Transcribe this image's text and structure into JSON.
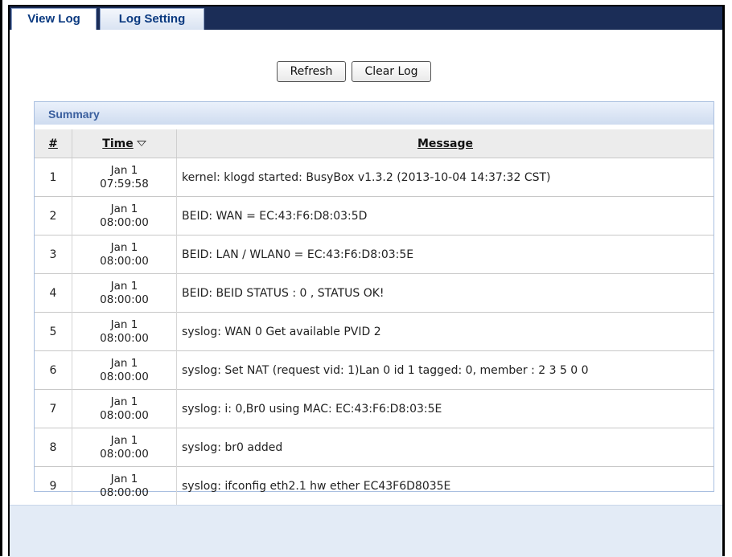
{
  "tabs": [
    {
      "label": "View Log",
      "active": true
    },
    {
      "label": "Log Setting",
      "active": false
    }
  ],
  "toolbar": {
    "refresh_label": "Refresh",
    "clear_label": "Clear Log"
  },
  "summary": {
    "title": "Summary",
    "columns": {
      "num": "#",
      "time": "Time",
      "message": "Message"
    },
    "sort_icon": "sort-descending-icon",
    "rows": [
      {
        "num": "1",
        "date": "Jan 1",
        "clock": "07:59:58",
        "message": "kernel: klogd started: BusyBox v1.3.2 (2013-10-04 14:37:32 CST)"
      },
      {
        "num": "2",
        "date": "Jan 1",
        "clock": "08:00:00",
        "message": "BEID: WAN = EC:43:F6:D8:03:5D"
      },
      {
        "num": "3",
        "date": "Jan 1",
        "clock": "08:00:00",
        "message": "BEID: LAN / WLAN0 = EC:43:F6:D8:03:5E"
      },
      {
        "num": "4",
        "date": "Jan 1",
        "clock": "08:00:00",
        "message": "BEID: BEID STATUS : 0 , STATUS OK!"
      },
      {
        "num": "5",
        "date": "Jan 1",
        "clock": "08:00:00",
        "message": "syslog: WAN 0 Get available PVID 2"
      },
      {
        "num": "6",
        "date": "Jan 1",
        "clock": "08:00:00",
        "message": "syslog: Set NAT (request vid: 1)Lan 0 id 1 tagged: 0, member : 2 3 5 0 0"
      },
      {
        "num": "7",
        "date": "Jan 1",
        "clock": "08:00:00",
        "message": "syslog: i: 0,Br0 using MAC: EC:43:F6:D8:03:5E"
      },
      {
        "num": "8",
        "date": "Jan 1",
        "clock": "08:00:00",
        "message": "syslog: br0 added"
      },
      {
        "num": "9",
        "date": "Jan 1",
        "clock": "08:00:00",
        "message": "syslog: ifconfig eth2.1 hw ether EC43F6D8035E"
      }
    ]
  },
  "colors": {
    "tabbar": "#1b2d57",
    "tab_text": "#0b3a80",
    "summary_title": "#3a5f9e",
    "footer": "#e3ebf6"
  }
}
